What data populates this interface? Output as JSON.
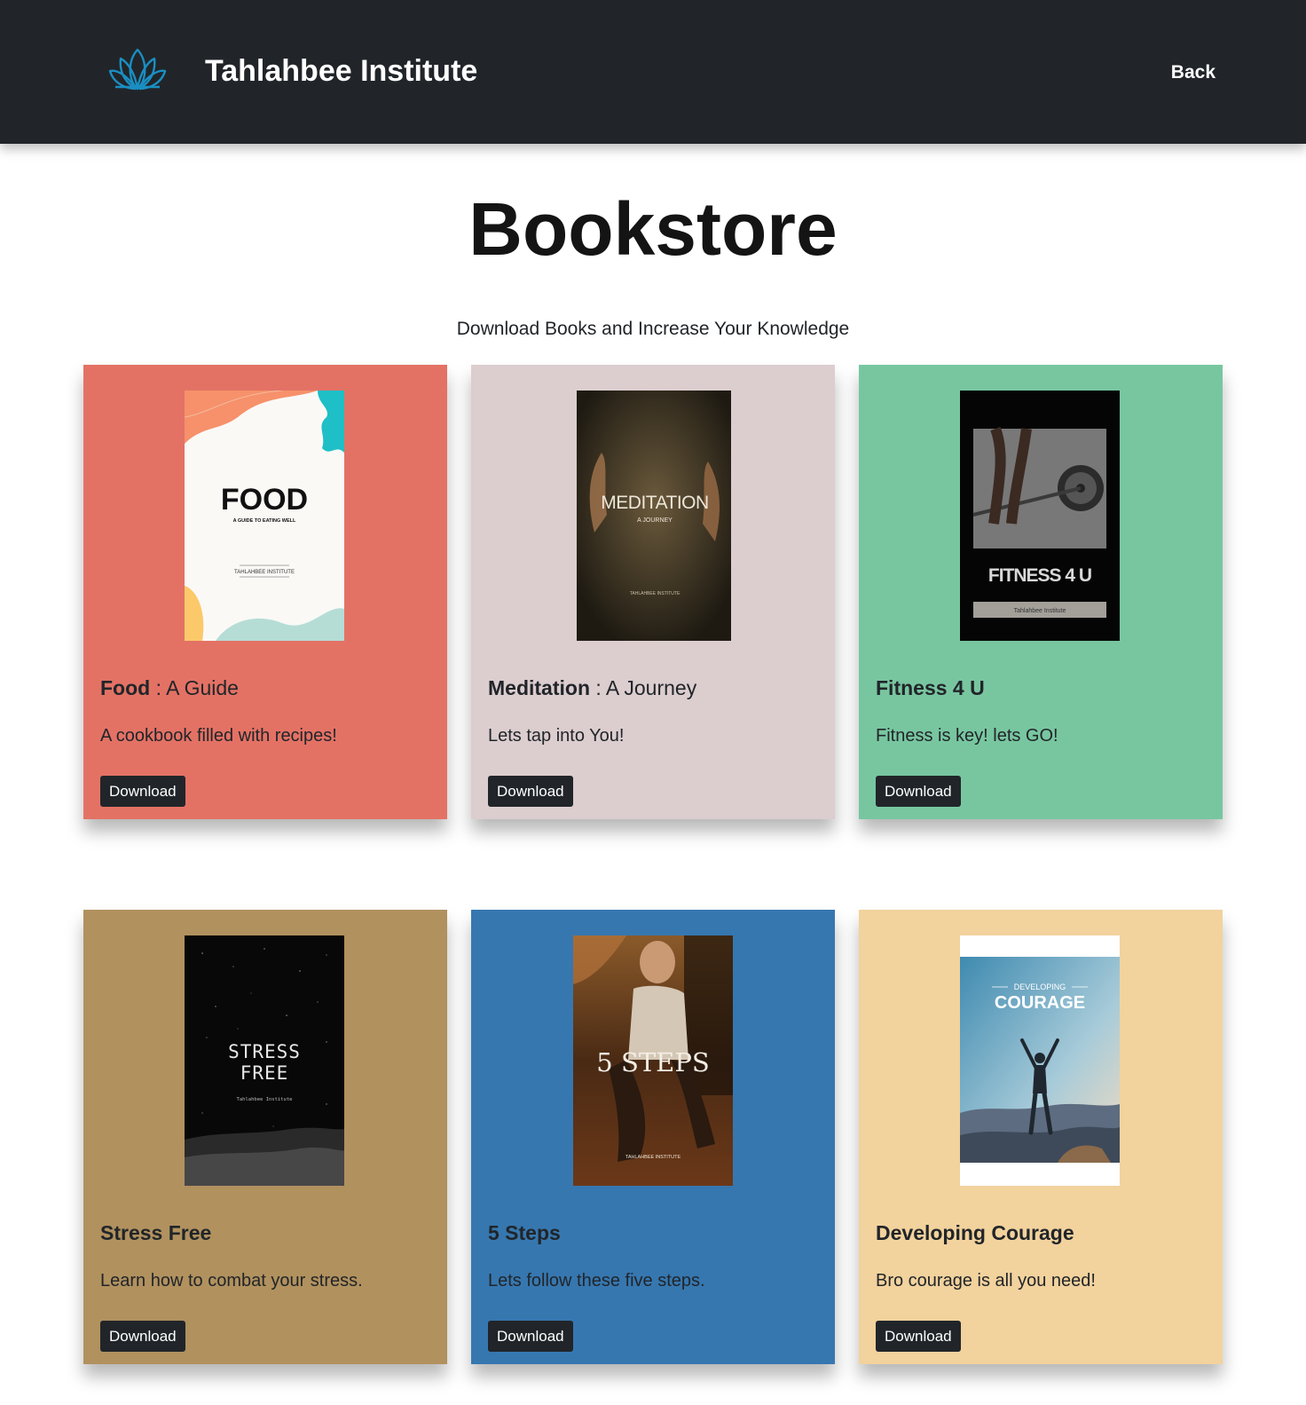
{
  "header": {
    "brand": "Tahlahbee Institute",
    "back_label": "Back",
    "logo_icon": "lotus-icon",
    "logo_color": "#1a8ec2",
    "background": "#212529"
  },
  "main": {
    "title": "Bookstore",
    "subtitle": "Download Books and Increase Your Knowledge"
  },
  "books": [
    {
      "title_bold": "Food",
      "title_rest": " : A Guide",
      "description": "A cookbook filled with recipes!",
      "button": "Download",
      "card_color": "#e37265",
      "cover": {
        "title": "FOOD",
        "subtitle": "A GUIDE TO EATING WELL",
        "publisher": "TAHLAHBEE INSTITUTE"
      }
    },
    {
      "title_bold": "Meditation",
      "title_rest": " : A Journey",
      "description": "Lets tap into You!",
      "button": "Download",
      "card_color": "#dccdcf",
      "cover": {
        "title": "MEDITATION",
        "subtitle": "A JOURNEY",
        "publisher": "TAHLAHBEE INSTITUTE"
      }
    },
    {
      "title_bold": "Fitness 4 U",
      "title_rest": "",
      "description": "Fitness is key! lets GO!",
      "button": "Download",
      "card_color": "#78c6a0",
      "cover": {
        "title": "FITNESS 4 U",
        "subtitle": "",
        "publisher": "Tahlahbee Institute"
      }
    },
    {
      "title_bold": "Stress Free",
      "title_rest": "",
      "description": "Learn how to combat your stress.",
      "button": "Download",
      "card_color": "#b1915e",
      "cover": {
        "title": "STRESS",
        "subtitle": "FREE",
        "publisher": "Tahlahbee Institute"
      }
    },
    {
      "title_bold": "5 Steps",
      "title_rest": "",
      "description": "Lets follow these five steps.",
      "button": "Download",
      "card_color": "#3677b0",
      "cover": {
        "title": "5 STEPS",
        "subtitle": "",
        "publisher": "TAHLAHBEE INSTITUTE"
      }
    },
    {
      "title_bold": "Developing Courage",
      "title_rest": "",
      "description": "Bro courage is all you need!",
      "button": "Download",
      "card_color": "#f2d29d",
      "cover": {
        "title": "COURAGE",
        "subtitle": "DEVELOPING",
        "publisher": ""
      }
    }
  ]
}
